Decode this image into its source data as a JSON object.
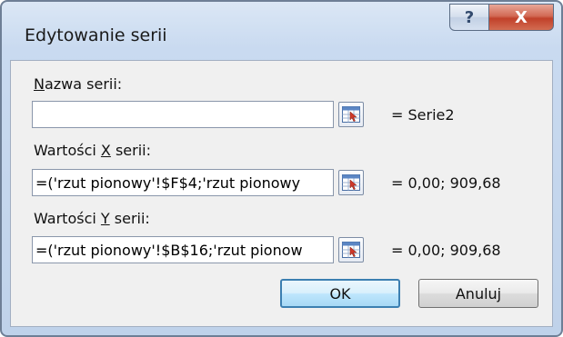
{
  "window": {
    "title": "Edytowanie serii",
    "help_label": "?",
    "close_label": "X"
  },
  "fields": {
    "name": {
      "label_pre": "",
      "label_mnemonic": "N",
      "label_post": "azwa serii:",
      "value": "",
      "result": "= Serie2"
    },
    "x_values": {
      "label_pre": "Wartości ",
      "label_mnemonic": "X",
      "label_post": " serii:",
      "value": "=('rzut pionowy'!$F$4;'rzut pionowy",
      "result": "= 0,00; 909,68"
    },
    "y_values": {
      "label_pre": "Wartości ",
      "label_mnemonic": "Y",
      "label_post": " serii:",
      "value": "=('rzut pionowy'!$B$16;'rzut pionow",
      "result": "= 0,00; 909,68"
    }
  },
  "buttons": {
    "ok": "OK",
    "cancel": "Anuluj"
  },
  "icons": {
    "range_selector": "range-selector-icon"
  },
  "colors": {
    "title_bar": "#c9daf0",
    "close_button": "#c1412a",
    "default_button_border": "#3c7fb1",
    "client_background": "#f0f0f0"
  }
}
